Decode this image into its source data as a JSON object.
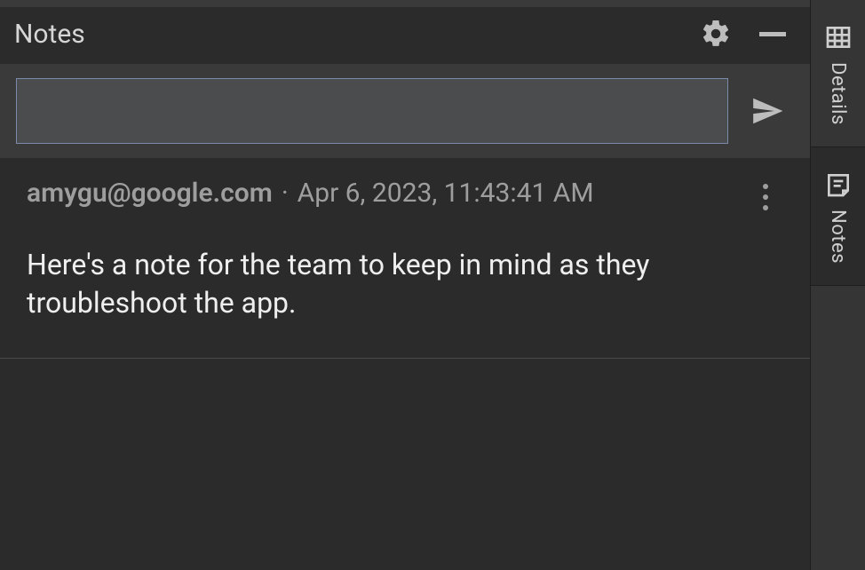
{
  "panel": {
    "title": "Notes"
  },
  "input": {
    "value": "",
    "placeholder": ""
  },
  "notes": [
    {
      "author": "amygu@google.com",
      "timestamp": "Apr 6, 2023, 11:43:41 AM",
      "body": "Here's a note for the team to keep in mind as they troubleshoot the app."
    }
  ],
  "rail": {
    "tabs": [
      {
        "label": "Details",
        "icon": "table-icon",
        "active": false
      },
      {
        "label": "Notes",
        "icon": "note-icon",
        "active": true
      }
    ]
  },
  "icons": {
    "gear": "gear-icon",
    "minimize": "minimize-icon",
    "send": "send-icon",
    "more": "more-vert-icon"
  }
}
